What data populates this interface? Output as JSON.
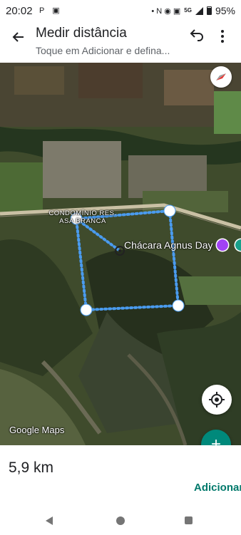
{
  "status": {
    "time": "20:02",
    "left_icons": "P ▣",
    "right_icons": "• N ◉ ▣",
    "network": "5G",
    "battery": "95%"
  },
  "app_bar": {
    "back_icon": "arrow-left-icon",
    "title": "Medir distância",
    "subtitle": "Toque em Adicionar e defina...",
    "undo_icon": "undo-icon",
    "menu_icon": "more-vert-icon"
  },
  "map": {
    "area_label": "CONDOMÍNIO RES. ASA BRANCA",
    "poi_label": "Chácara Agnus Day",
    "watermark": "Google Maps",
    "compass_icon": "compass-icon",
    "locate_icon": "my-location-icon",
    "add_icon": "plus-icon",
    "add_symbol": "+",
    "route_color": "#4a9bef",
    "fab_color": "#00897b"
  },
  "bottom": {
    "distance": "5,9 km",
    "add_label": "Adicionar"
  },
  "nav": {
    "back_icon": "nav-back-icon",
    "home_icon": "nav-home-icon",
    "recent_icon": "nav-recent-icon"
  }
}
